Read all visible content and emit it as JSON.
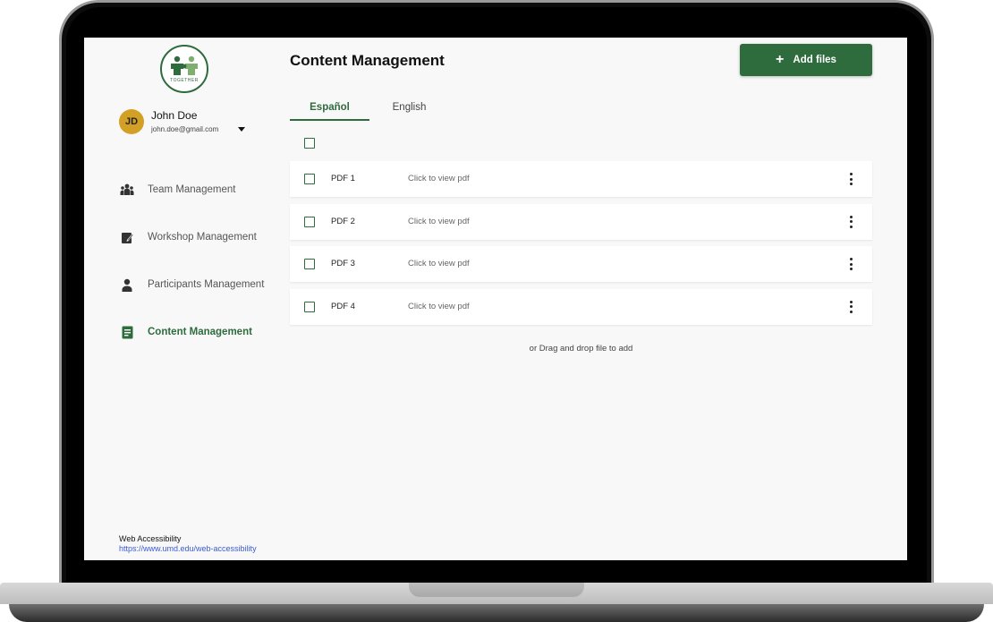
{
  "logo": {
    "text": "TOGETHER"
  },
  "user": {
    "initials": "JD",
    "name": "John Doe",
    "email": "john.doe@gmail.com"
  },
  "nav": [
    {
      "label": "Team Management",
      "icon": "team-icon",
      "active": false
    },
    {
      "label": "Workshop Management",
      "icon": "workshop-icon",
      "active": false
    },
    {
      "label": "Participants Management",
      "icon": "person-icon",
      "active": false
    },
    {
      "label": "Content Management",
      "icon": "document-icon",
      "active": true
    }
  ],
  "footer": {
    "title": "Web Accessibility",
    "link": "https://www.umd.edu/web-accessibility"
  },
  "header": {
    "title": "Content Management",
    "add_label": "Add files",
    "add_icon": "+"
  },
  "tabs": [
    {
      "label": "Español",
      "active": true
    },
    {
      "label": "English",
      "active": false
    }
  ],
  "files": [
    {
      "name": "PDF 1",
      "action": "Click to view pdf"
    },
    {
      "name": "PDF 2",
      "action": "Click to view pdf"
    },
    {
      "name": "PDF 3",
      "action": "Click to view pdf"
    },
    {
      "name": "PDF 4",
      "action": "Click to view pdf"
    }
  ],
  "dropzone": {
    "text": "or Drag and drop file to add"
  },
  "colors": {
    "brand": "#2e6b3d",
    "avatar": "#d2a024",
    "link": "#3a5bd9"
  }
}
